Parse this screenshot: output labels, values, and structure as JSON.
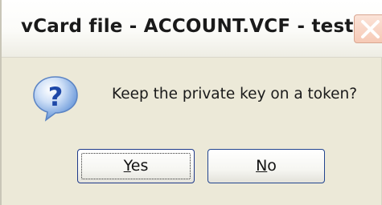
{
  "window": {
    "title": "vCard file - ACCOUNT.VCF - test",
    "close_icon": "close-icon"
  },
  "dialog": {
    "icon": "question-icon",
    "message": "Keep the private key on a token?"
  },
  "buttons": {
    "yes": {
      "mnemonic": "Y",
      "rest": "es",
      "default": true
    },
    "no": {
      "mnemonic": "N",
      "rest": "o",
      "default": false
    }
  },
  "colors": {
    "dialog_background": "#ece9d8",
    "close_button": "#f6c9b6",
    "button_border": "#1f3a8a",
    "question_icon_blue": "#2c6fd1"
  }
}
